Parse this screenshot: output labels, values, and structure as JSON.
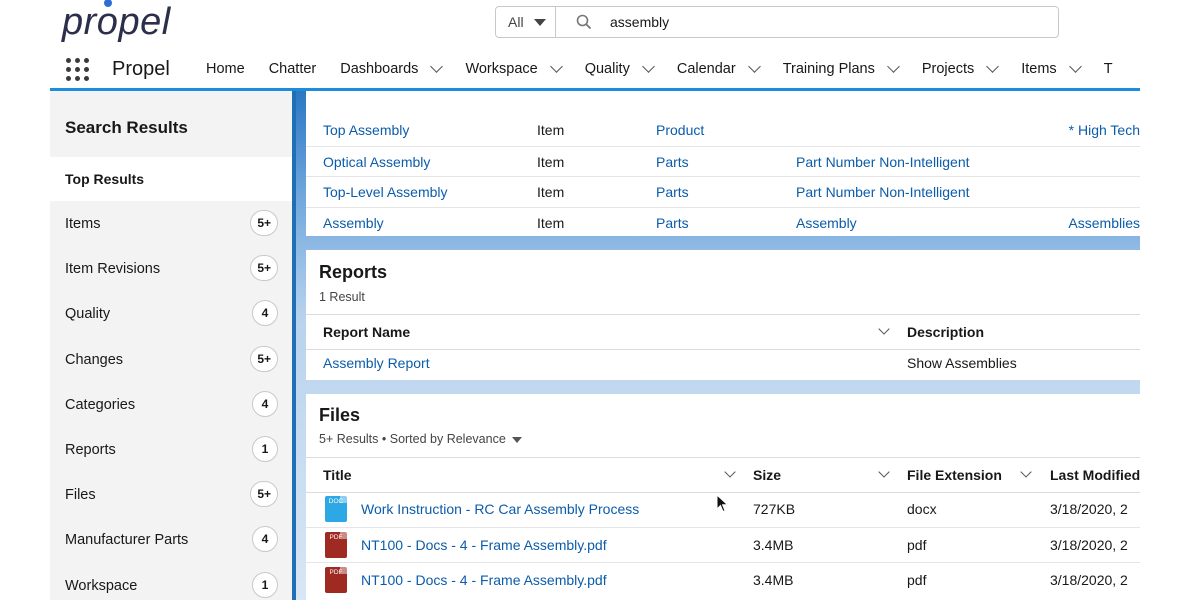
{
  "header": {
    "logo_pre": "pr",
    "logo_o": "o",
    "logo_post": "pel",
    "search_scope": "All",
    "search_value": "assembly"
  },
  "nav": {
    "app_name": "Propel",
    "items": [
      {
        "label": "Home",
        "has_menu": false
      },
      {
        "label": "Chatter",
        "has_menu": false
      },
      {
        "label": "Dashboards",
        "has_menu": true
      },
      {
        "label": "Workspace",
        "has_menu": true
      },
      {
        "label": "Quality",
        "has_menu": true
      },
      {
        "label": "Calendar",
        "has_menu": true
      },
      {
        "label": "Training Plans",
        "has_menu": true
      },
      {
        "label": "Projects",
        "has_menu": true
      },
      {
        "label": "Items",
        "has_menu": true
      },
      {
        "label": "T",
        "has_menu": false
      }
    ]
  },
  "sidebar": {
    "title": "Search Results",
    "top_results": "Top Results",
    "items": [
      {
        "label": "Items",
        "count": "5+"
      },
      {
        "label": "Item Revisions",
        "count": "5+"
      },
      {
        "label": "Quality",
        "count": "4"
      },
      {
        "label": "Changes",
        "count": "5+"
      },
      {
        "label": "Categories",
        "count": "4"
      },
      {
        "label": "Reports",
        "count": "1"
      },
      {
        "label": "Files",
        "count": "5+"
      },
      {
        "label": "Manufacturer Parts",
        "count": "4"
      },
      {
        "label": "Workspace",
        "count": "1"
      }
    ]
  },
  "items_table": {
    "rows": [
      {
        "name": "Top Assembly",
        "type": "Item",
        "category": "Product",
        "numbering": "",
        "extra": "* High Tech"
      },
      {
        "name": "Optical Assembly",
        "type": "Item",
        "category": "Parts",
        "numbering": "Part Number Non-Intelligent",
        "extra": ""
      },
      {
        "name": "Top-Level Assembly",
        "type": "Item",
        "category": "Parts",
        "numbering": "Part Number Non-Intelligent",
        "extra": ""
      },
      {
        "name": "Assembly",
        "type": "Item",
        "category": "Parts",
        "numbering": "Assembly",
        "extra": "Assemblies"
      }
    ]
  },
  "reports": {
    "title": "Reports",
    "subtitle": "1 Result",
    "col_name": "Report Name",
    "col_desc": "Description",
    "rows": [
      {
        "name": "Assembly Report",
        "description": "Show Assemblies"
      }
    ]
  },
  "files": {
    "title": "Files",
    "subtitle": "5+ Results • Sorted by Relevance",
    "col_title": "Title",
    "col_size": "Size",
    "col_ext": "File Extension",
    "col_modified": "Last Modified",
    "rows": [
      {
        "icon": "doc",
        "icon_text": "DOC",
        "title": "Work Instruction - RC Car Assembly Process",
        "size": "727KB",
        "ext": "docx",
        "modified": "3/18/2020, 2"
      },
      {
        "icon": "pdf",
        "icon_text": "PDF",
        "title": "NT100 - Docs - 4 - Frame Assembly.pdf",
        "size": "3.4MB",
        "ext": "pdf",
        "modified": "3/18/2020, 2"
      },
      {
        "icon": "pdf",
        "icon_text": "PDF",
        "title": "NT100 - Docs - 4 - Frame Assembly.pdf",
        "size": "3.4MB",
        "ext": "pdf",
        "modified": "3/18/2020, 2"
      }
    ]
  }
}
